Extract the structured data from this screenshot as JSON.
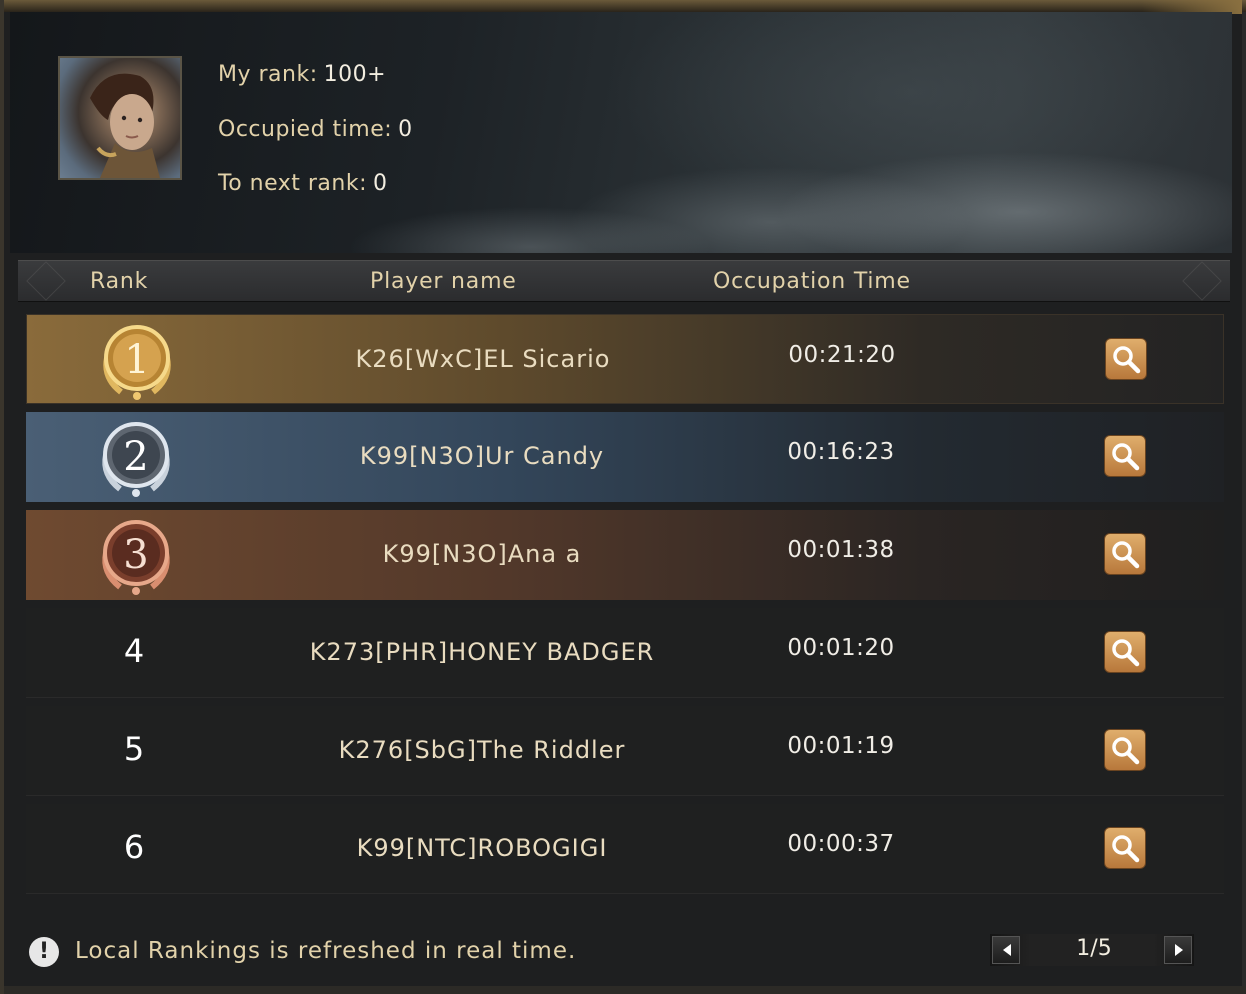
{
  "profile": {
    "my_rank_label": "My rank:",
    "my_rank_value": "100+",
    "occupied_label": "Occupied time:",
    "occupied_value": "0",
    "next_rank_label": "To next rank:",
    "next_rank_value": "0"
  },
  "table": {
    "headers": [
      "Rank",
      "Player name",
      "Occupation Time"
    ],
    "rows": [
      {
        "rank": "1",
        "player": "K26[WxC]EL Sicario",
        "time": "00:21:20",
        "style": "gold"
      },
      {
        "rank": "2",
        "player": "K99[N3O]Ur Candy",
        "time": "00:16:23",
        "style": "silver"
      },
      {
        "rank": "3",
        "player": "K99[N3O]Ana a",
        "time": "00:01:38",
        "style": "bronze"
      },
      {
        "rank": "4",
        "player": "K273[PHR]HONEY BADGER",
        "time": "00:01:20",
        "style": "plain"
      },
      {
        "rank": "5",
        "player": "K276[SbG]The Riddler",
        "time": "00:01:19",
        "style": "plain"
      },
      {
        "rank": "6",
        "player": "K99[NTC]ROBOGIGI",
        "time": "00:00:37",
        "style": "plain"
      }
    ]
  },
  "footer": {
    "notice_icon": "!",
    "notice": "Local Rankings is refreshed in real time.",
    "page": "1/5"
  },
  "colors": {
    "gold": "#8a6b3b",
    "silver": "#4a5f75",
    "bronze": "#6f4a30",
    "text_gold": "#e2d2aa",
    "button": "#d39a57"
  },
  "icons": {
    "row_action": "search-icon",
    "pager_prev": "triangle-left-icon",
    "pager_next": "triangle-right-icon",
    "notice": "exclamation-icon"
  }
}
